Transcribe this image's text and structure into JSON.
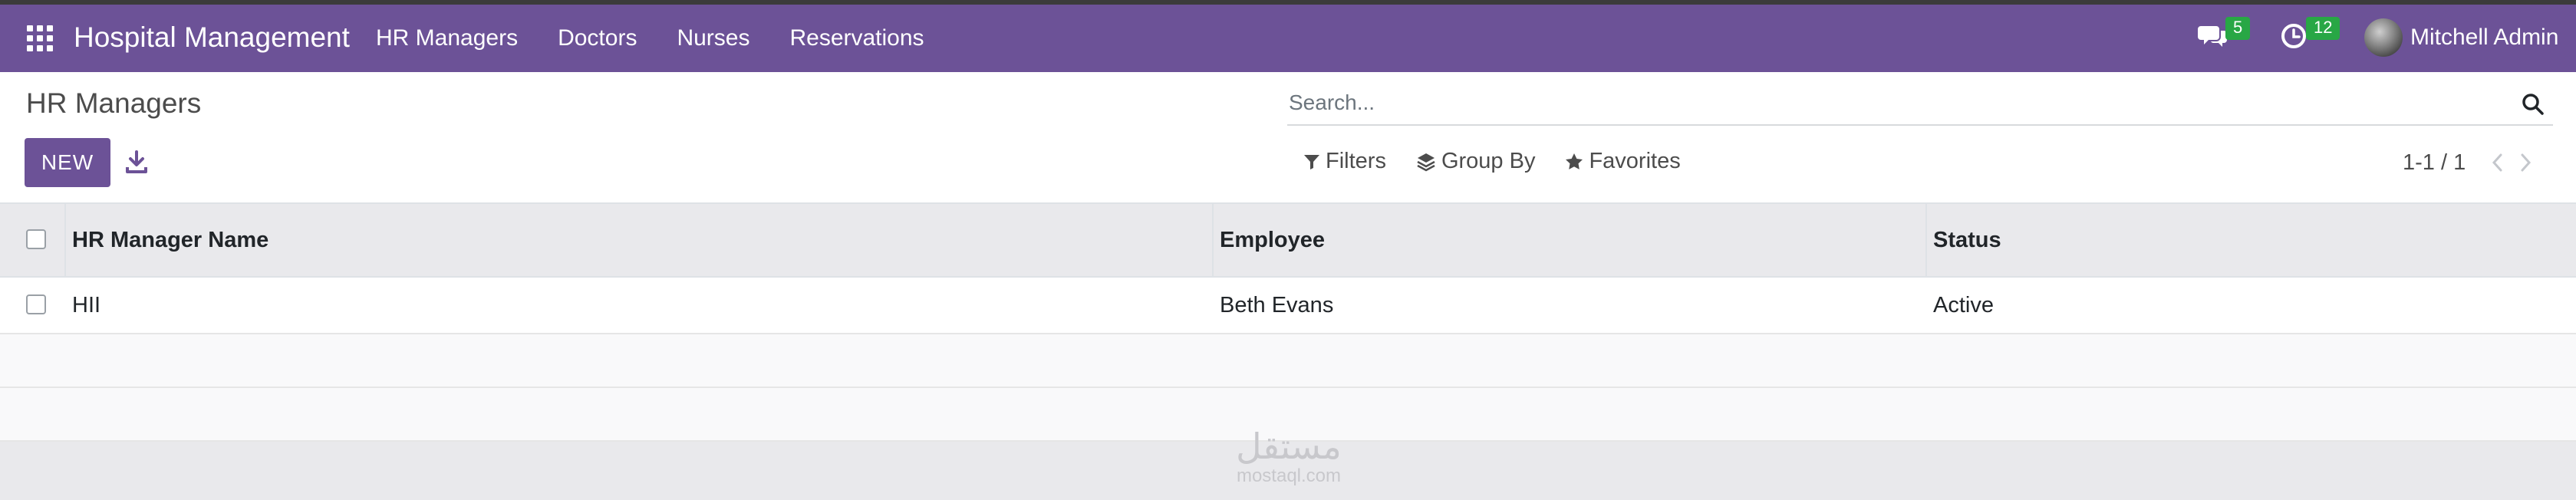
{
  "navbar": {
    "brand": "Hospital Management",
    "menu": [
      "HR Managers",
      "Doctors",
      "Nurses",
      "Reservations"
    ],
    "chat_count": "5",
    "activity_count": "12",
    "user_name": "Mitchell Admin"
  },
  "control_panel": {
    "title": "HR Managers",
    "new_label": "NEW",
    "search_placeholder": "Search...",
    "filters_label": "Filters",
    "group_by_label": "Group By",
    "favorites_label": "Favorites",
    "pager": "1-1 / 1"
  },
  "table": {
    "columns": [
      "HR Manager Name",
      "Employee",
      "Status"
    ],
    "rows": [
      {
        "name": "HII",
        "employee": "Beth Evans",
        "status": "Active"
      }
    ]
  },
  "watermark": {
    "arabic": "مستقل",
    "latin": "mostaql.com"
  },
  "colors": {
    "brand": "#6c5297",
    "badge": "#28a745"
  }
}
